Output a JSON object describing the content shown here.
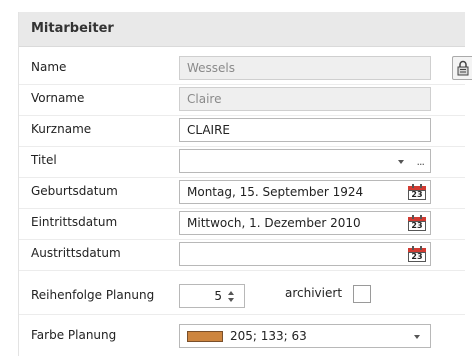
{
  "panel": {
    "title": "Mitarbeiter"
  },
  "fields": {
    "name": {
      "label": "Name",
      "value": "Wessels"
    },
    "vorname": {
      "label": "Vorname",
      "value": "Claire"
    },
    "kurzname": {
      "label": "Kurzname",
      "value": "CLAIRE"
    },
    "titel": {
      "label": "Titel",
      "value": ""
    },
    "geburtsdatum": {
      "label": "Geburtsdatum",
      "value": "Montag, 15. September 1924"
    },
    "eintrittsdatum": {
      "label": "Eintrittsdatum",
      "value": "Mittwoch, 1. Dezember 2010"
    },
    "austrittsdatum": {
      "label": "Austrittsdatum",
      "value": ""
    },
    "reihenfolge": {
      "label": "Reihenfolge Planung",
      "value": "5"
    },
    "archiviert": {
      "label": "archiviert",
      "checked": false
    },
    "farbe": {
      "label": "Farbe Planung",
      "value": "205; 133; 63",
      "color": "#cd853f"
    }
  },
  "calendar_day": "23",
  "ellipsis": "···",
  "icons": {
    "lock": "lock-icon",
    "calendar": "calendar-icon",
    "dropdown": "chevron-down-icon",
    "more": "ellipsis-icon",
    "spin": "spin-updown-icon"
  }
}
